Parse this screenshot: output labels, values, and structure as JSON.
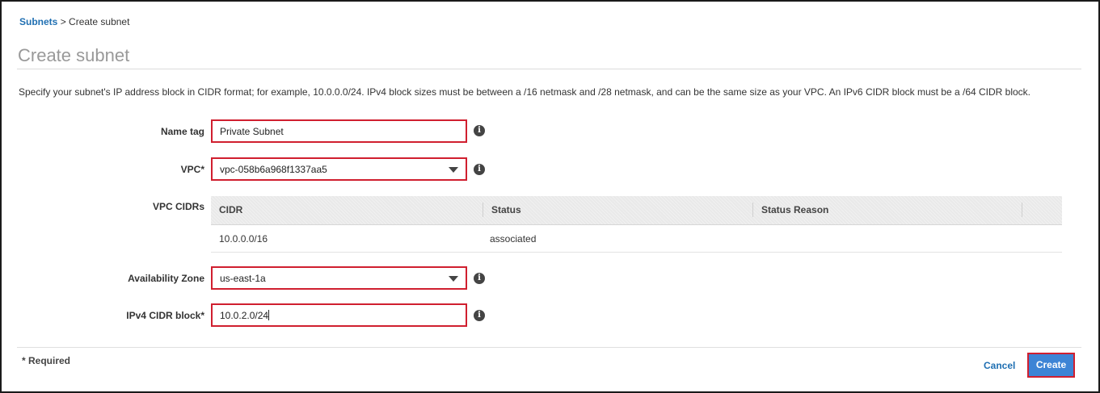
{
  "breadcrumb": {
    "parent": "Subnets",
    "separator": ">",
    "current": "Create subnet"
  },
  "page_title": "Create subnet",
  "description": "Specify your subnet's IP address block in CIDR format; for example, 10.0.0.0/24. IPv4 block sizes must be between a /16 netmask and /28 netmask, and can be the same size as your VPC. An IPv6 CIDR block must be a /64 CIDR block.",
  "form": {
    "name_tag": {
      "label": "Name tag",
      "value": "Private Subnet"
    },
    "vpc": {
      "label": "VPC*",
      "value": "vpc-058b6a968f1337aa5"
    },
    "vpc_cidrs": {
      "label": "VPC CIDRs",
      "columns": [
        "CIDR",
        "Status",
        "Status Reason"
      ],
      "rows": [
        {
          "cidr": "10.0.0.0/16",
          "status": "associated",
          "status_reason": ""
        }
      ]
    },
    "availability_zone": {
      "label": "Availability Zone",
      "value": "us-east-1a"
    },
    "ipv4_cidr": {
      "label": "IPv4 CIDR block*",
      "value": "10.0.2.0/24"
    }
  },
  "info_icon_glyph": "i",
  "footer": {
    "required_note": "* Required",
    "cancel_label": "Cancel",
    "create_label": "Create"
  },
  "colors": {
    "link": "#1f6fb2",
    "highlight_border": "#d01f2f",
    "primary_button": "#3d84d5"
  }
}
